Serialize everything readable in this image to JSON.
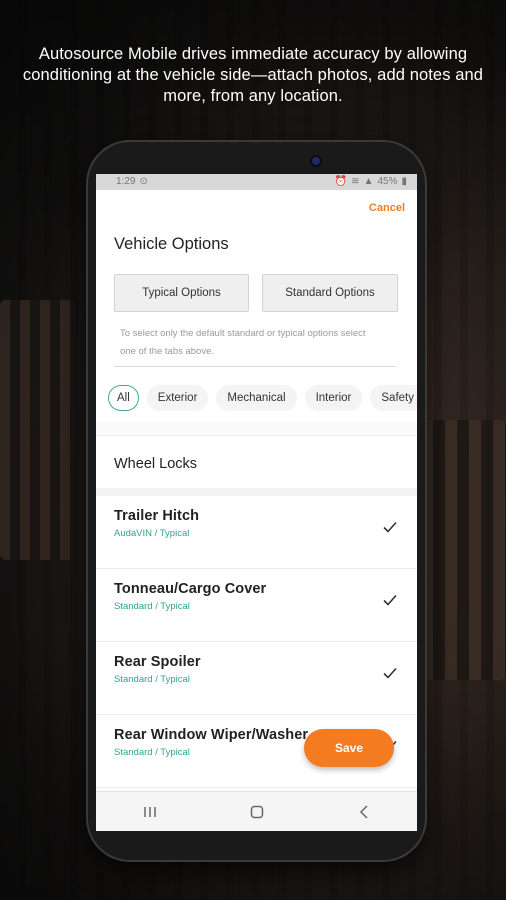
{
  "headline": "Autosource Mobile drives immediate accuracy by allowing conditioning at the vehicle side—attach photos, add notes and more, from any location.",
  "statusbar": {
    "time": "1:29",
    "battery": "45%"
  },
  "header": {
    "cancel_label": "Cancel",
    "title": "Vehicle Options"
  },
  "option_tabs": {
    "typical_label": "Typical Options",
    "standard_label": "Standard Options"
  },
  "hint": "To select only the default standard or typical options select one of the tabs above.",
  "filters": [
    {
      "label": "All",
      "active": true
    },
    {
      "label": "Exterior"
    },
    {
      "label": "Mechanical"
    },
    {
      "label": "Interior"
    },
    {
      "label": "Safety"
    }
  ],
  "list": {
    "header_item": "Wheel Locks",
    "items": [
      {
        "name": "Trailer Hitch",
        "source": "AudaVIN / Typical",
        "checked": true
      },
      {
        "name": "Tonneau/Cargo Cover",
        "source": "Standard / Typical",
        "checked": true
      },
      {
        "name": "Rear Spoiler",
        "source": "Standard / Typical",
        "checked": true
      },
      {
        "name": "Rear Window Wiper/Washer",
        "source": "Standard / Typical",
        "checked": true
      }
    ]
  },
  "save_label": "Save",
  "colors": {
    "accent": "#f47b20",
    "teal": "#2fa48f",
    "chip_active_border": "#46a89a"
  }
}
